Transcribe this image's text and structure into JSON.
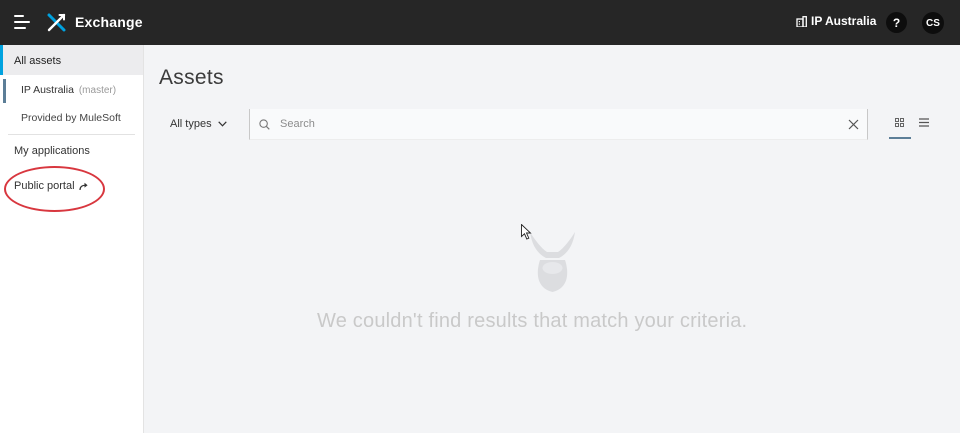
{
  "header": {
    "app_title": "Exchange",
    "org_name": "IP Australia",
    "help_label": "?",
    "user_initials": "CS",
    "icons": {
      "menu": "hamburger-menu-icon",
      "logo": "exchange-logo-icon",
      "org": "building-icon"
    },
    "colors": {
      "bar": "#262626",
      "logo_accent": "#00a2df"
    }
  },
  "sidebar": {
    "all_assets": "All assets",
    "org_item": {
      "label": "IP Australia",
      "suffix": "(master)"
    },
    "mulesoft_item": "Provided by MuleSoft",
    "my_applications": "My applications",
    "public_portal": "Public portal",
    "public_portal_icon": "external-share-arrow-icon",
    "colors": {
      "active_indicator": "#00a2df",
      "highlight_ring": "#d8373f"
    }
  },
  "main": {
    "title": "Assets",
    "type_filter": "All types",
    "search": {
      "placeholder": "Search",
      "value": ""
    },
    "view_modes": [
      "grid-view-icon",
      "list-view-icon"
    ],
    "selected_view": "grid",
    "empty_message": "We couldn't find results that match your criteria."
  }
}
